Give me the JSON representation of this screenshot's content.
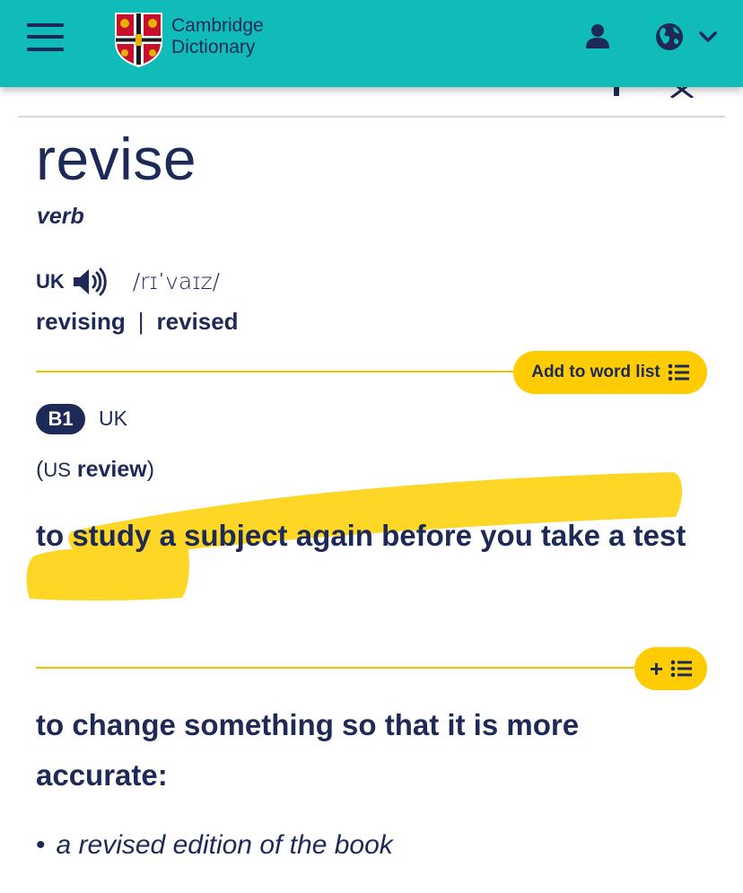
{
  "header": {
    "logo_line1": "Cambridge",
    "logo_line2": "Dictionary",
    "user_icon": "user-icon",
    "language_icon": "globe-icon",
    "bg_color": "#0fbcb7"
  },
  "entry": {
    "headword": "revise",
    "part_of_speech": "verb",
    "region": "UK",
    "ipa": "/rɪˈvaɪz/",
    "inflection_1": "revising",
    "inflection_sep": "|",
    "inflection_2": "revised"
  },
  "sense1": {
    "add_button_label": "Add to word list",
    "level": "B1",
    "region": "UK",
    "variant_open": "(",
    "variant_region": "US",
    "variant_word": "review",
    "variant_close": ")",
    "definition": "to study a subject again before you take a test"
  },
  "sense2": {
    "add_button_label": "+",
    "definition": "to change something so that it is more accurate:",
    "example": "a revised edition of the book",
    "bullet": "•"
  },
  "colors": {
    "accent": "#fecc00",
    "text": "#1d2a57",
    "highlight": "#fdd20e"
  }
}
